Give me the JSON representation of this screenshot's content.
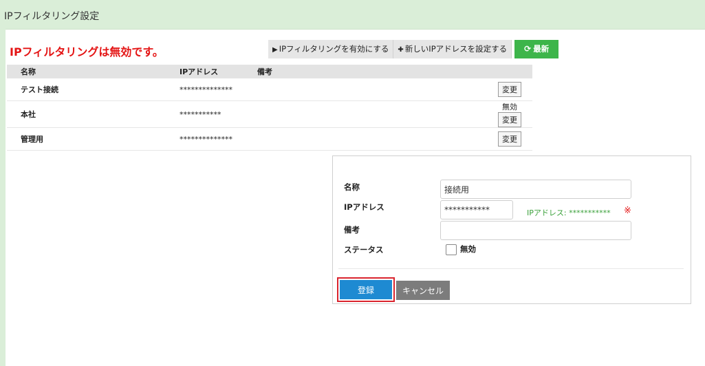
{
  "page": {
    "title": "IPフィルタリング設定"
  },
  "status": {
    "message": "IPフィルタリングは無効です。"
  },
  "toolbar": {
    "enable_label": "IPフィルタリングを有効にする",
    "new_label": "新しいIPアドレスを設定する",
    "refresh_label": "最新"
  },
  "table": {
    "headers": {
      "name": "名称",
      "ip": "IPアドレス",
      "note": "備考"
    },
    "change_label": "変更",
    "rows": [
      {
        "name": "テスト接続",
        "ip": "**************",
        "note": "",
        "status": ""
      },
      {
        "name": "本社",
        "ip": "***********",
        "note": "",
        "status": "無効"
      },
      {
        "name": "管理用",
        "ip": "**************",
        "note": "",
        "status": ""
      }
    ]
  },
  "form": {
    "name_label": "名称",
    "name_value": "接続用",
    "ip_label": "IPアドレス",
    "ip_value": "***********",
    "ip_hint": "IPアドレス: ***********",
    "required_mark": "※",
    "note_label": "備考",
    "note_value": "",
    "status_label": "ステータス",
    "disabled_label": "無効",
    "disabled_checked": false,
    "submit_label": "登録",
    "cancel_label": "キャンセル"
  },
  "colors": {
    "header_bg": "#daeed8",
    "alert": "#e41414",
    "refresh": "#3db54a",
    "submit": "#1e8ad2",
    "highlight": "#d9232d",
    "hint": "#3aa03a"
  }
}
